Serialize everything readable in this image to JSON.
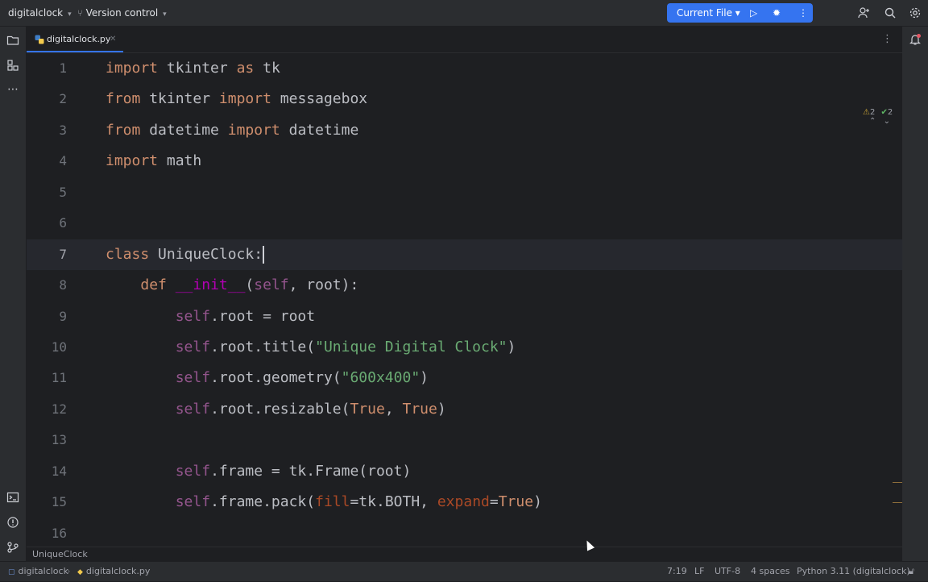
{
  "titlebar": {
    "project": "digitalclock",
    "vcs": "Version control",
    "run_config": "Current File"
  },
  "tab": {
    "name": "digitalclock.py"
  },
  "inspection": {
    "warnings": "2",
    "ok": "2"
  },
  "code_lines": [
    {
      "n": "1"
    },
    {
      "n": "2"
    },
    {
      "n": "3"
    },
    {
      "n": "4"
    },
    {
      "n": "5"
    },
    {
      "n": "6"
    },
    {
      "n": "7"
    },
    {
      "n": "8"
    },
    {
      "n": "9"
    },
    {
      "n": "10"
    },
    {
      "n": "11"
    },
    {
      "n": "12"
    },
    {
      "n": "13"
    },
    {
      "n": "14"
    },
    {
      "n": "15"
    },
    {
      "n": "16"
    }
  ],
  "tokens": {
    "l1": [
      "import",
      " tkinter ",
      "as",
      " tk"
    ],
    "l2": [
      "from",
      " tkinter ",
      "import",
      " messagebox"
    ],
    "l3": [
      "from",
      " datetime ",
      "import",
      " datetime"
    ],
    "l4": [
      "import",
      " math"
    ],
    "l7": [
      "class",
      " UniqueClock:"
    ],
    "l8": [
      "    ",
      "def",
      " ",
      "__init__",
      "(",
      "self",
      ", root):"
    ],
    "l9": [
      "        ",
      "self",
      ".root = root"
    ],
    "l10": [
      "        ",
      "self",
      ".root.title(",
      "\"Unique Digital Clock\"",
      ")"
    ],
    "l11": [
      "        ",
      "self",
      ".root.geometry(",
      "\"600x400\"",
      ")"
    ],
    "l12": [
      "        ",
      "self",
      ".root.resizable(",
      "True",
      ", ",
      "True",
      ")"
    ],
    "l14": [
      "        ",
      "self",
      ".frame = tk.Frame(root)"
    ],
    "l15": [
      "        ",
      "self",
      ".frame.pack(",
      "fill",
      "=tk.BOTH, ",
      "expand",
      "=",
      "True",
      ")"
    ]
  },
  "breadcrumb": "UniqueClock",
  "status": {
    "project": "digitalclock",
    "file": "digitalclock.py",
    "position": "7:19",
    "line_ending": "LF",
    "encoding": "UTF-8",
    "indent": "4 spaces",
    "interpreter": "Python 3.11 (digitalclock)"
  }
}
